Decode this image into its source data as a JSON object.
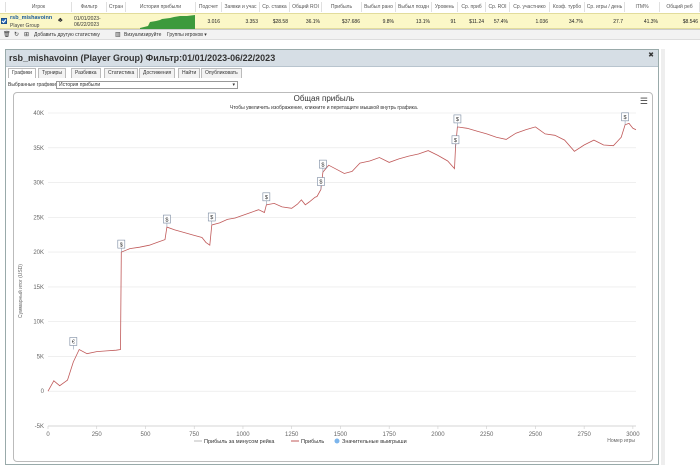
{
  "table": {
    "headers": [
      "Игрок",
      "Фильтр",
      "Стран",
      "История прибыли",
      "Подсчет",
      "Заявки и учас",
      "Ср. ставка",
      "Общий ROI",
      "Прибыль",
      "Выбыл ранo",
      "Выбыл поздн",
      "Уровень",
      "Ср. приб",
      "Ср. ROI",
      "Ср. участнико",
      "Коэф. турбо",
      "Ср. игры / день",
      "ITM%",
      "Общий реб"
    ],
    "row": {
      "player": "rsb_mishavoinn",
      "group": "Player Group",
      "filter_line1": "01/01/2023-",
      "filter_line2": "06/22/2023",
      "cells": [
        "3.016",
        "3.353",
        "$28.58",
        "36.1%",
        "$37.686",
        "9.8%",
        "13.1%",
        "91",
        "$11.24",
        "57.4%",
        "1.036",
        "34.7%",
        "27.7",
        "41.3%",
        "$8.546"
      ]
    }
  },
  "toolbar": {
    "add_stats": "Добавить другую статистику",
    "visualize": "Визуализируйте",
    "player_groups": "Группы игроков ▾"
  },
  "panel": {
    "title": "rsb_mishavoinn (Player Group) Фильтр:01/01/2023-06/22/2023",
    "tabs": [
      "Графики",
      "Турниры",
      "Разбивка",
      "Статистика",
      "Достижения",
      "Найти",
      "Опубликовать"
    ],
    "graph_select_label": "Выбранные графики:",
    "graph_select_value": "История прибыли"
  },
  "chart_data": {
    "type": "line",
    "title": "Общая прибыль",
    "subtitle": "Чтобы увеличить изображение, кликните и перетащите мышкой внутрь графика.",
    "xlabel": "Номер игры",
    "ylabel": "Суммарный итог (USD)",
    "xlim": [
      0,
      3016
    ],
    "ylim": [
      -5000,
      40000
    ],
    "x_ticks": [
      0,
      250,
      500,
      750,
      1000,
      1250,
      1500,
      1750,
      2000,
      2250,
      2500,
      2750,
      3000
    ],
    "y_ticks": [
      -5000,
      0,
      5000,
      10000,
      15000,
      20000,
      25000,
      30000,
      35000,
      40000
    ],
    "y_tick_labels": [
      "-5K",
      "0",
      "5K",
      "10K",
      "15K",
      "20K",
      "25K",
      "30K",
      "35K",
      "40K"
    ],
    "grid": true,
    "colors": {
      "profit": "#c05a5a",
      "rake": "#bbbbbb",
      "big_win": "#7cb5ec"
    },
    "series": [
      {
        "name": "Прибыль",
        "points": [
          [
            0,
            0
          ],
          [
            30,
            1500
          ],
          [
            60,
            800
          ],
          [
            100,
            1600
          ],
          [
            130,
            4200
          ],
          [
            160,
            6000
          ],
          [
            200,
            5400
          ],
          [
            250,
            5700
          ],
          [
            300,
            5800
          ],
          [
            350,
            5900
          ],
          [
            372,
            6000
          ],
          [
            376,
            20000
          ],
          [
            420,
            20500
          ],
          [
            470,
            20700
          ],
          [
            520,
            21000
          ],
          [
            560,
            21400
          ],
          [
            600,
            21800
          ],
          [
            610,
            23600
          ],
          [
            650,
            23200
          ],
          [
            700,
            22800
          ],
          [
            750,
            22400
          ],
          [
            790,
            22100
          ],
          [
            810,
            21400
          ],
          [
            830,
            21000
          ],
          [
            840,
            23900
          ],
          [
            880,
            24200
          ],
          [
            920,
            24700
          ],
          [
            960,
            24900
          ],
          [
            1000,
            25300
          ],
          [
            1040,
            25700
          ],
          [
            1080,
            26100
          ],
          [
            1110,
            25700
          ],
          [
            1120,
            26800
          ],
          [
            1160,
            27000
          ],
          [
            1200,
            26500
          ],
          [
            1250,
            26300
          ],
          [
            1280,
            26900
          ],
          [
            1300,
            27500
          ],
          [
            1320,
            26800
          ],
          [
            1340,
            27200
          ],
          [
            1370,
            27900
          ],
          [
            1380,
            28000
          ],
          [
            1400,
            29000
          ],
          [
            1410,
            31500
          ],
          [
            1440,
            32500
          ],
          [
            1480,
            31900
          ],
          [
            1520,
            31300
          ],
          [
            1560,
            31600
          ],
          [
            1600,
            32800
          ],
          [
            1650,
            33100
          ],
          [
            1700,
            33600
          ],
          [
            1750,
            32900
          ],
          [
            1800,
            33400
          ],
          [
            1850,
            33800
          ],
          [
            1900,
            34100
          ],
          [
            1950,
            34600
          ],
          [
            2000,
            33900
          ],
          [
            2050,
            33100
          ],
          [
            2085,
            32000
          ],
          [
            2090,
            35000
          ],
          [
            2100,
            38000
          ],
          [
            2150,
            37800
          ],
          [
            2200,
            37400
          ],
          [
            2250,
            37000
          ],
          [
            2300,
            36500
          ],
          [
            2350,
            36200
          ],
          [
            2400,
            37100
          ],
          [
            2450,
            37600
          ],
          [
            2500,
            38000
          ],
          [
            2550,
            37000
          ],
          [
            2600,
            36800
          ],
          [
            2650,
            36100
          ],
          [
            2700,
            34500
          ],
          [
            2750,
            35400
          ],
          [
            2800,
            36100
          ],
          [
            2850,
            35400
          ],
          [
            2900,
            35300
          ],
          [
            2920,
            35900
          ],
          [
            2940,
            36500
          ],
          [
            2960,
            38300
          ],
          [
            2980,
            38500
          ],
          [
            3000,
            37800
          ],
          [
            3016,
            37600
          ]
        ]
      },
      {
        "name": "Прибыль за минусом рейка",
        "points": []
      }
    ],
    "markers": [
      {
        "x": 130,
        "y": 6000,
        "label": "€"
      },
      {
        "x": 376,
        "y": 20000,
        "label": "$"
      },
      {
        "x": 610,
        "y": 23600,
        "label": "$"
      },
      {
        "x": 840,
        "y": 23900,
        "label": "$"
      },
      {
        "x": 1120,
        "y": 26800,
        "label": "$"
      },
      {
        "x": 1400,
        "y": 29000,
        "label": "$"
      },
      {
        "x": 1410,
        "y": 31500,
        "label": "$"
      },
      {
        "x": 2090,
        "y": 35000,
        "label": "$"
      },
      {
        "x": 2100,
        "y": 38000,
        "label": "$"
      },
      {
        "x": 2960,
        "y": 38300,
        "label": "$"
      }
    ],
    "legend": [
      "Прибыль за минусом рейка",
      "Прибыль",
      "Значительные выигрыши"
    ],
    "legend_position": "bottom"
  }
}
